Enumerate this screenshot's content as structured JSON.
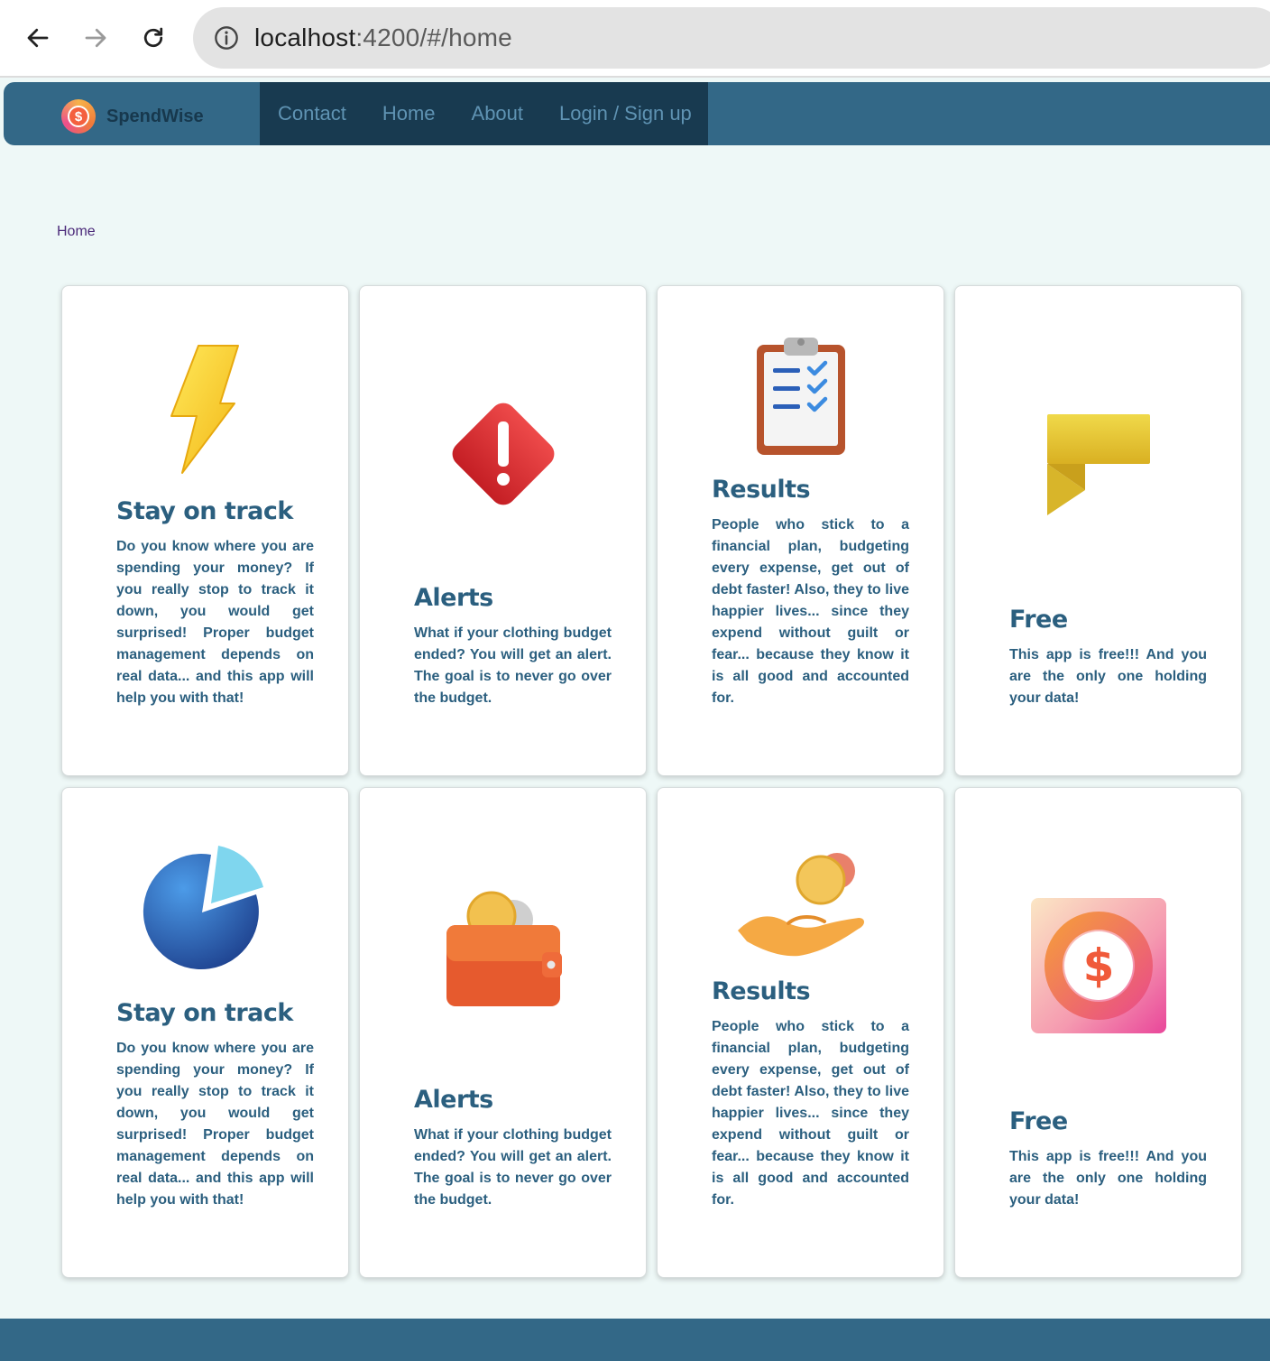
{
  "browser": {
    "url_host": "localhost",
    "url_rest": ":4200/#/home",
    "back_icon": "arrow-left-icon",
    "forward_icon": "arrow-right-icon",
    "reload_icon": "reload-icon",
    "info_icon": "info-icon"
  },
  "nav": {
    "brand": "SpendWise",
    "links": [
      "Contact",
      "Home",
      "About",
      "Login / Sign up"
    ]
  },
  "breadcrumb": "Home",
  "cards": [
    {
      "icon": "lightning-bolt-icon",
      "title": "Stay on track",
      "text": "Do you know where you are spending your money? If you really stop to track it down, you would get surprised! Proper budget management depends on real data... and this app will help you with that!"
    },
    {
      "icon": "alert-diamond-icon",
      "title": "Alerts",
      "text": "What if your clothing budget ended? You will get an alert. The goal is to never go over the budget."
    },
    {
      "icon": "clipboard-checklist-icon",
      "title": "Results",
      "text": "People who stick to a financial plan, budgeting every expense, get out of debt faster! Also, they to live happier lives... since they expend without guilt or fear... because they know it is all good and accounted for."
    },
    {
      "icon": "flag-icon",
      "title": "Free",
      "text": "This app is free!!! And you are the only one holding your data!"
    },
    {
      "icon": "pie-chart-icon",
      "title": "Stay on track",
      "text": "Do you know where you are spending your money? If you really stop to track it down, you would get surprised! Proper budget management depends on real data... and this app will help you with that!"
    },
    {
      "icon": "wallet-coin-icon",
      "title": "Alerts",
      "text": "What if your clothing budget ended? You will get an alert. The goal is to never go over the budget."
    },
    {
      "icon": "hand-coins-icon",
      "title": "Results",
      "text": "People who stick to a financial plan, budgeting every expense, get out of debt faster! Also, they to live happier lives... since they expend without guilt or fear... because they know it is all good and accounted for."
    },
    {
      "icon": "dollar-app-icon",
      "title": "Free",
      "text": "This app is free!!! And you are the only one holding your data!"
    }
  ],
  "colors": {
    "nav_bg": "#336887",
    "nav_links_bg": "#183a50",
    "page_bg": "#eef8f7",
    "text": "#2b5f7f"
  }
}
